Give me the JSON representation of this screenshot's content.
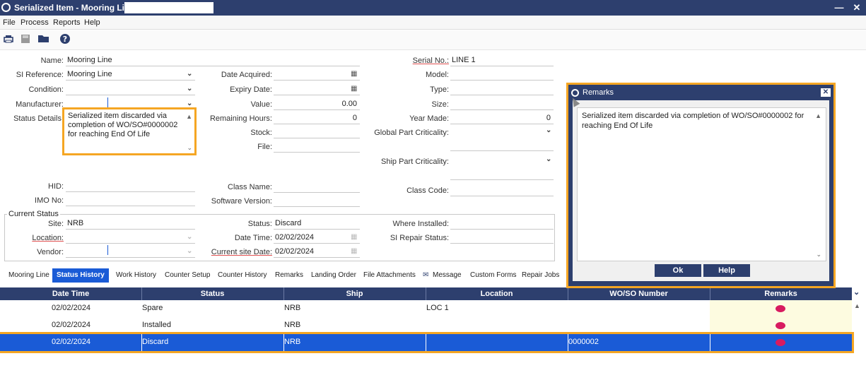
{
  "window": {
    "title": "Serialized Item - Mooring Line -",
    "minimize": "—",
    "close": "✕"
  },
  "menu": [
    "File",
    "Process",
    "Reports",
    "Help"
  ],
  "form": {
    "name_label": "Name:",
    "name_value": "Mooring Line",
    "si_reference_label": "SI Reference:",
    "si_reference_value": "Mooring Line",
    "condition_label": "Condition:",
    "condition_value": "",
    "manufacturer_label": "Manufacturer:",
    "manufacturer_value": "",
    "status_details_label": "Status Details:",
    "status_details_value": "Serialized item discarded via completion of WO/SO#0000002 for reaching End Of Life",
    "date_acquired_label": "Date Acquired:",
    "date_acquired_value": "",
    "expiry_date_label": "Expiry Date:",
    "expiry_date_value": "",
    "value_label": "Value:",
    "value_value": "0.00",
    "remaining_hours_label": "Remaining Hours:",
    "remaining_hours_value": "0",
    "stock_label": "Stock:",
    "stock_value": "",
    "file_label": "File:",
    "file_value": "",
    "serial_no_label": "Serial No.:",
    "serial_no_value": "LINE 1",
    "model_label": "Model:",
    "model_value": "",
    "type_label": "Type:",
    "type_value": "",
    "size_label": "Size:",
    "size_value": "",
    "year_made_label": "Year Made:",
    "year_made_value": "0",
    "global_part_criticality_label": "Global Part Criticality:",
    "ship_part_criticality_label": "Ship Part Criticality:",
    "hid_label": "HID:",
    "imo_no_label": "IMO No:",
    "class_name_label": "Class Name:",
    "software_version_label": "Software Version:",
    "class_code_label": "Class Code:"
  },
  "current_status": {
    "group_title": "Current Status",
    "site_label": "Site:",
    "site_value": "NRB",
    "location_label": "Location:",
    "location_value": "",
    "vendor_label": "Vendor:",
    "vendor_value": "",
    "status_label": "Status:",
    "status_value": "Discard",
    "date_time_label": "Date Time:",
    "date_time_value": "02/02/2024",
    "current_site_date_label": "Current site Date:",
    "current_site_date_value": "02/02/2024",
    "where_installed_label": "Where Installed:",
    "si_repair_status_label": "SI Repair Status:"
  },
  "tabs": [
    "Mooring Line",
    "Status History",
    "Work History",
    "Counter Setup",
    "Counter History",
    "Remarks",
    "Landing Order",
    "File Attachments",
    "Message",
    "Custom Forms",
    "Repair Jobs"
  ],
  "grid": {
    "columns": [
      "Date Time",
      "Status",
      "Ship",
      "Location",
      "WO/SO Number",
      "Remarks"
    ],
    "rows": [
      {
        "date": "02/02/2024",
        "status": "Spare",
        "ship": "NRB",
        "location": "LOC 1",
        "wo": ""
      },
      {
        "date": "02/02/2024",
        "status": "Installed",
        "ship": "NRB",
        "location": "",
        "wo": ""
      },
      {
        "date": "02/02/2024",
        "status": "Discard",
        "ship": "NRB",
        "location": "",
        "wo": "0000002"
      }
    ]
  },
  "remarks_dialog": {
    "title": "Remarks",
    "text": "Serialized item discarded via completion of WO/SO#0000002 for reaching End Of Life",
    "ok": "Ok",
    "help": "Help"
  },
  "colors": {
    "accent": "#2d3f6e",
    "selection": "#1a5bd6",
    "highlight": "#f5a623",
    "remark_icon": "#d81b60"
  },
  "icons": [
    "app-icon",
    "print-icon",
    "save-icon",
    "folder-icon",
    "help-icon",
    "chevron-down-icon",
    "calendar-icon",
    "comment-icon",
    "envelope-icon"
  ]
}
